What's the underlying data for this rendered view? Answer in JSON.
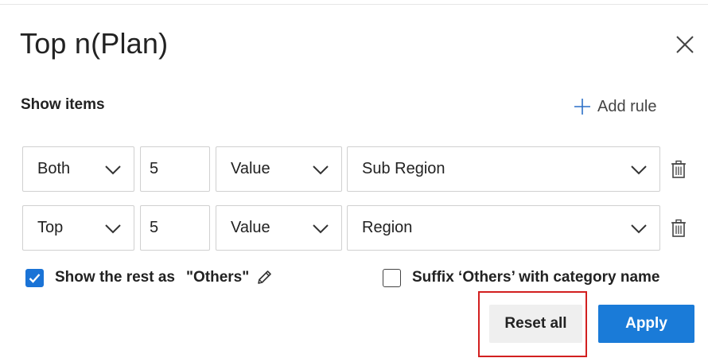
{
  "dialog": {
    "title": "Top n(Plan)",
    "section_label": "Show items",
    "add_rule_label": "Add rule"
  },
  "rules": [
    {
      "direction": "Both",
      "count": "5",
      "by": "Value",
      "field": "Sub Region"
    },
    {
      "direction": "Top",
      "count": "5",
      "by": "Value",
      "field": "Region"
    }
  ],
  "options": {
    "show_rest": {
      "checked": true,
      "label": "Show the rest as",
      "value": "\"Others\""
    },
    "suffix": {
      "checked": false,
      "label": "Suffix ‘Others’ with category name"
    }
  },
  "buttons": {
    "reset_label": "Reset all",
    "apply_label": "Apply"
  },
  "colors": {
    "accent": "#1a7bd8",
    "checkbox": "#1a73d6",
    "highlight": "#d21f1f",
    "secondary_button": "#efefef"
  },
  "icons": [
    "close-icon",
    "plus-icon",
    "chevron-down-icon",
    "trash-icon",
    "checkmark-icon",
    "pencil-icon"
  ]
}
